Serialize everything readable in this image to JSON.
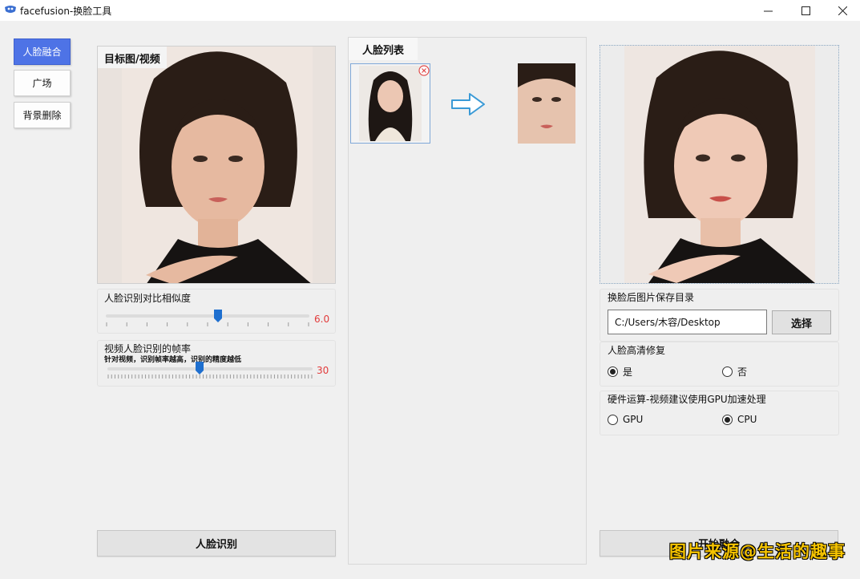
{
  "window": {
    "title": "facefusion-换脸工具",
    "minimize": "—",
    "maximize": "☐",
    "close": "✕"
  },
  "nav": {
    "items": [
      {
        "label": "人脸融合",
        "active": true
      },
      {
        "label": "广场",
        "active": false
      },
      {
        "label": "背景删除",
        "active": false
      }
    ]
  },
  "target": {
    "tag": "目标图/视频"
  },
  "similarity": {
    "label": "人脸识别对比相似度",
    "value": "6.0",
    "fraction": 0.55
  },
  "framerate": {
    "label": "视频人脸识别的帧率",
    "hint": "针对视频，识别帧率越高，识别的精度越低",
    "value": "30",
    "fraction": 0.45
  },
  "detect_button": "人脸识别",
  "face_list": {
    "tab": "人脸列表"
  },
  "save_dir": {
    "label": "换脸后图片保存目录",
    "value": "C:/Users/木容/Desktop",
    "button": "选择"
  },
  "hd_repair": {
    "label": "人脸高清修复",
    "options": [
      {
        "label": "是",
        "checked": true
      },
      {
        "label": "否",
        "checked": false
      }
    ]
  },
  "hardware": {
    "label": "硬件运算-视频建议使用GPU加速处理",
    "options": [
      {
        "label": "GPU",
        "checked": false
      },
      {
        "label": "CPU",
        "checked": true
      }
    ]
  },
  "fuse_button": "开始融合",
  "watermark": "图片来源@生活的趣事",
  "colors": {
    "accent": "#4e73e6",
    "value_red": "#e23b3b",
    "thumb_blue": "#1e6fcf"
  }
}
